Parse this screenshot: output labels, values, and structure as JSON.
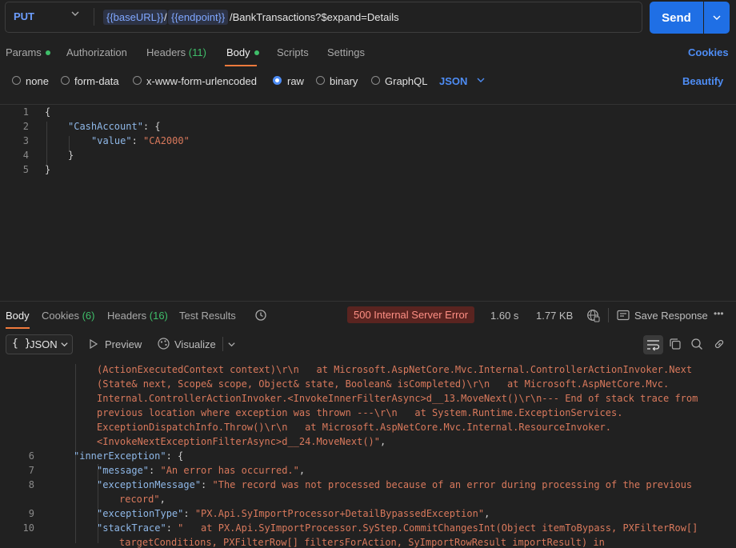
{
  "request": {
    "method": "PUT",
    "url_var_base": "{{baseURL}}",
    "url_sep": "/",
    "url_var_endpoint": "{{endpoint}}",
    "url_path": "/BankTransactions?$expand=Details",
    "send_label": "Send"
  },
  "request_tabs": {
    "params": "Params",
    "authorization": "Authorization",
    "headers": "Headers",
    "headers_count": "(11)",
    "body": "Body",
    "scripts": "Scripts",
    "settings": "Settings",
    "cookies": "Cookies"
  },
  "body_types": {
    "none": "none",
    "form_data": "form-data",
    "urlencoded": "x-www-form-urlencoded",
    "raw": "raw",
    "binary": "binary",
    "graphql": "GraphQL",
    "language": "JSON",
    "beautify": "Beautify"
  },
  "request_body": {
    "line_numbers": [
      "1",
      "2",
      "3",
      "4",
      "5"
    ],
    "open_brace": "{",
    "key_cash_account": "\"CashAccount\"",
    "colon_brace": ": {",
    "key_value": "\"value\"",
    "colon": ": ",
    "value_string": "\"CA2000\"",
    "inner_close": "}",
    "outer_close": "}"
  },
  "response_tabs": {
    "body": "Body",
    "cookies": "Cookies",
    "cookies_count": "(6)",
    "headers": "Headers",
    "headers_count": "(16)",
    "test_results": "Test Results",
    "status": "500 Internal Server Error",
    "time": "1.60 s",
    "size": "1.77 KB",
    "save_response": "Save Response",
    "more": "•••"
  },
  "response_toolbar": {
    "format_icon": "{ }",
    "format": "JSON",
    "preview": "Preview",
    "visualize": "Visualize"
  },
  "response_body": {
    "cont_1": "(ActionExecutedContext context)\\r\\n   at Microsoft.AspNetCore.Mvc.Internal.ControllerActionInvoker.Next",
    "cont_2": "(State& next, Scope& scope, Object& state, Boolean& isCompleted)\\r\\n   at Microsoft.AspNetCore.Mvc.",
    "cont_3": "Internal.ControllerActionInvoker.<InvokeInnerFilterAsync>d__13.MoveNext()\\r\\n--- End of stack trace from",
    "cont_4": "previous location where exception was thrown ---\\r\\n   at System.Runtime.ExceptionServices.",
    "cont_5": "ExceptionDispatchInfo.Throw()\\r\\n   at Microsoft.AspNetCore.Mvc.Internal.ResourceInvoker.",
    "cont_6": "<InvokeNextExceptionFilterAsync>d__24.MoveNext()\"",
    "comma": ",",
    "line6_num": "6",
    "line6_key": "\"innerException\"",
    "line6_rest": ": {",
    "line7_num": "7",
    "line7_key": "\"message\"",
    "line7_val": "\"An error has occurred.\"",
    "line8_num": "8",
    "line8_key": "\"exceptionMessage\"",
    "line8_val_a": "\"The record was not processed because of an error during processing of the previous",
    "line8_val_b": "record\"",
    "line9_num": "9",
    "line9_key": "\"exceptionType\"",
    "line9_val": "\"PX.Api.SyImportProcessor+DetailBypassedException\"",
    "line10_num": "10",
    "line10_key": "\"stackTrace\"",
    "line10_val_a": "\"   at PX.Api.SyImportProcessor.SyStep.CommitChangesInt(Object itemToBypass, PXFilterRow[]",
    "line10_val_b": "targetConditions, PXFilterRow[] filtersForAction, SyImportRowResult importResult) in"
  },
  "colors": {
    "accent_blue": "#1f6fe5",
    "tab_underline": "#f07a3c",
    "error_text": "#ff8f84"
  }
}
